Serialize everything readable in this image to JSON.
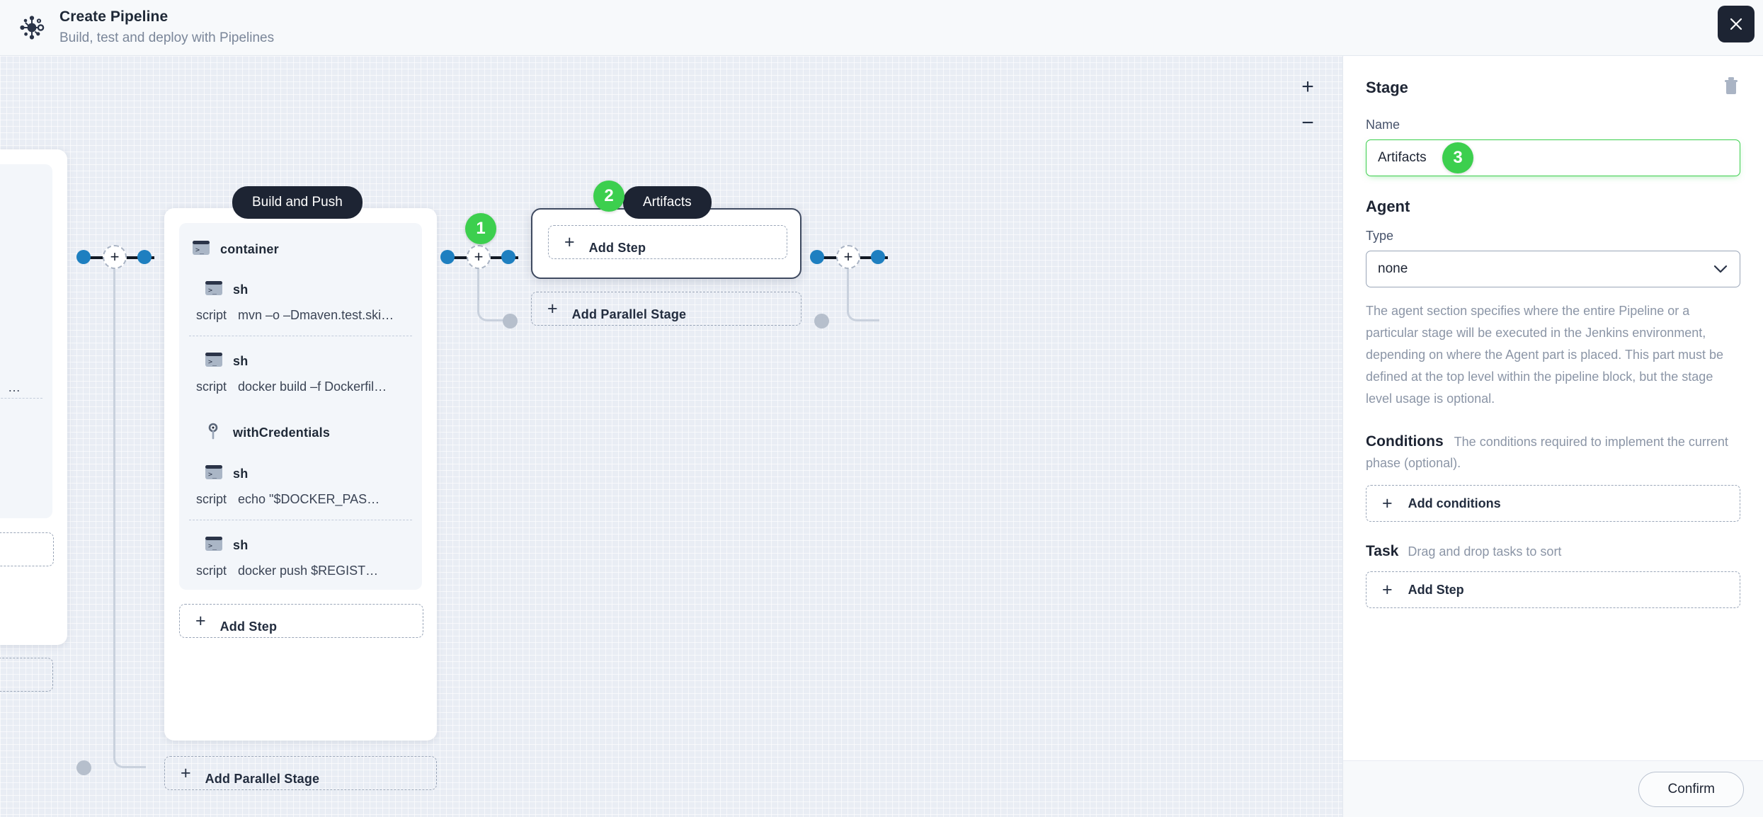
{
  "header": {
    "logo_icon": "jenkins-pipeline-icon",
    "title": "Create Pipeline",
    "subtitle": "Build, test and deploy with Pipelines",
    "close_icon": "close-icon"
  },
  "canvas": {
    "zoom_in_label": "+",
    "zoom_out_label": "−",
    "connector_plus_label": "+",
    "badges": [
      {
        "number": "1"
      },
      {
        "number": "2"
      },
      {
        "number": "3"
      }
    ],
    "stages": [
      {
        "label": "Build and Push",
        "selected": false,
        "add_step_label": "Add Step",
        "add_parallel_label": "Add Parallel Stage",
        "steps": [
          {
            "icon": "terminal-icon",
            "name": "container",
            "indent": false,
            "script_key": null,
            "script_value": null
          },
          {
            "icon": "terminal-icon",
            "name": "sh",
            "indent": true,
            "script_key": "script",
            "script_value": "mvn –o –Dmaven.test.ski…"
          },
          {
            "icon": "terminal-icon",
            "name": "sh",
            "indent": true,
            "script_key": "script",
            "script_value": "docker build –f Dockerfil…"
          },
          {
            "icon": "key-icon",
            "name": "withCredentials",
            "indent": true,
            "script_key": null,
            "script_value": null
          },
          {
            "icon": "terminal-icon",
            "name": "sh",
            "indent": true,
            "script_key": "script",
            "script_value": "echo \"$DOCKER_PAS…"
          },
          {
            "icon": "terminal-icon",
            "name": "sh",
            "indent": true,
            "script_key": "script",
            "script_value": "docker push $REGIST…"
          }
        ]
      },
      {
        "label": "Artifacts",
        "selected": true,
        "add_step_label": "Add Step",
        "add_parallel_label": "Add Parallel Stage",
        "steps": []
      }
    ]
  },
  "panel": {
    "title": "Stage",
    "delete_icon": "trash-icon",
    "name_label": "Name",
    "name_value": "Artifacts",
    "agent_heading": "Agent",
    "type_label": "Type",
    "type_value": "none",
    "type_chevron_icon": "chevron-down-icon",
    "agent_help": "The agent section specifies where the entire Pipeline or a particular stage will be executed in the Jenkins environment, depending on where the Agent part is placed. This part must be defined at the top level within the pipeline block, but the stage level usage is optional.",
    "conditions_heading": "Conditions",
    "conditions_help": "The conditions required to implement the current phase (optional).",
    "add_conditions_label": "Add conditions",
    "task_heading": "Task",
    "task_help": "Drag and drop tasks to sort",
    "add_step_label": "Add Step",
    "confirm_label": "Confirm"
  },
  "colors": {
    "accent_green": "#3ccf4e",
    "node_blue": "#1e7fc0",
    "dark": "#1d2433",
    "canvas_bg": "#e9edf4"
  }
}
